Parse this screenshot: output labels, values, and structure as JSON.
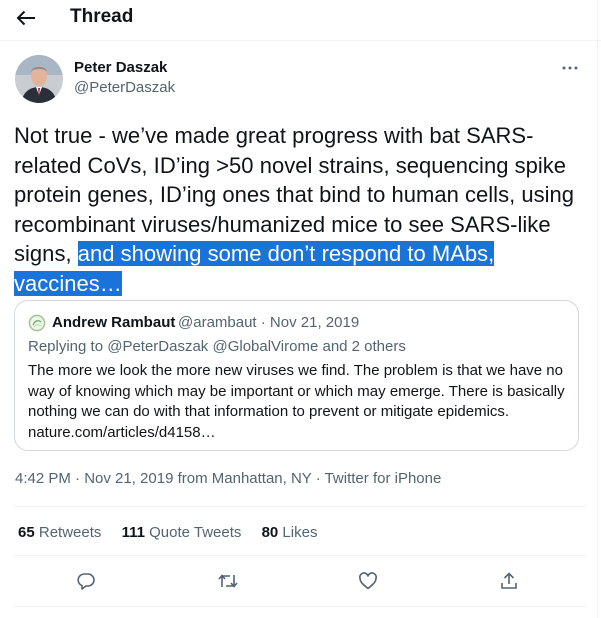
{
  "header": {
    "title": "Thread",
    "back_icon": "arrow-left-icon"
  },
  "tweet": {
    "author_name": "Peter Daszak",
    "author_handle": "@PeterDaszak",
    "text_plain": "Not true - we’ve made great progress with bat SARS-related CoVs, ID’ing >50 novel strains, sequencing spike protein genes, ID’ing ones that bind to human cells, using recombinant viruses/humanized mice to see SARS-like signs, ",
    "text_highlighted": "and showing some don’t respond to MAbs, vaccines…",
    "highlight_color": "#1a73d9",
    "meta": "4:42 PM · Nov 21, 2019 from Manhattan, NY · Twitter for iPhone"
  },
  "quote": {
    "author_name": "Andrew Rambaut",
    "author_meta": "@arambaut · Nov 21, 2019",
    "replying": "Replying to @PeterDaszak @GlobalVirome and 2 others",
    "body": "The more we look the more new viruses we find. The problem is that we have no way of knowing which may be important or which may emerge. There is basically nothing we can do with that information to prevent or mitigate epidemics. nature.com/articles/d4158…"
  },
  "stats": {
    "retweets_count": "65",
    "retweets_label": "Retweets",
    "quotes_count": "111",
    "quotes_label": "Quote Tweets",
    "likes_count": "80",
    "likes_label": "Likes"
  },
  "colors": {
    "text": "#0f1419",
    "secondary": "#536471",
    "border": "#cfd9de",
    "divider": "#eff3f4"
  }
}
